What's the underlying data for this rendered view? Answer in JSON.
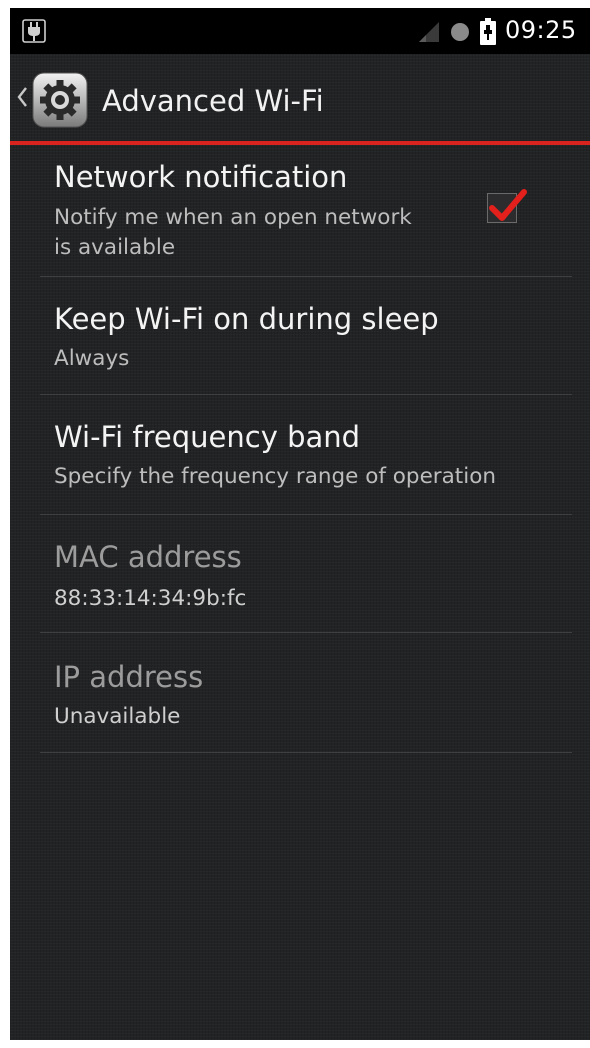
{
  "status_bar": {
    "time": "09:25",
    "icons": [
      "usb-debugging-icon",
      "signal-strength-icon",
      "notification-dot-icon",
      "battery-charging-icon"
    ]
  },
  "action_bar": {
    "title": "Advanced Wi-Fi",
    "icons": [
      "back-chevron-icon",
      "settings-app-icon"
    ]
  },
  "preferences": [
    {
      "title": "Network notification",
      "summary_line1": "Notify me when an open network",
      "summary_line2": "is available",
      "checked": true,
      "enabled": true
    },
    {
      "title": "Keep Wi-Fi on during sleep",
      "summary": "Always",
      "enabled": true
    },
    {
      "title": "Wi-Fi frequency band",
      "summary": "Specify the frequency range of operation",
      "enabled": true
    },
    {
      "title": "MAC address",
      "summary": "88:33:14:34:9b:fc",
      "enabled": false
    },
    {
      "title": "IP address",
      "summary": "Unavailable",
      "enabled": false
    }
  ],
  "colors": {
    "accent": "#d8231f",
    "checkmark": "#e3201b",
    "background": "#222325",
    "status_bar": "#000000"
  }
}
